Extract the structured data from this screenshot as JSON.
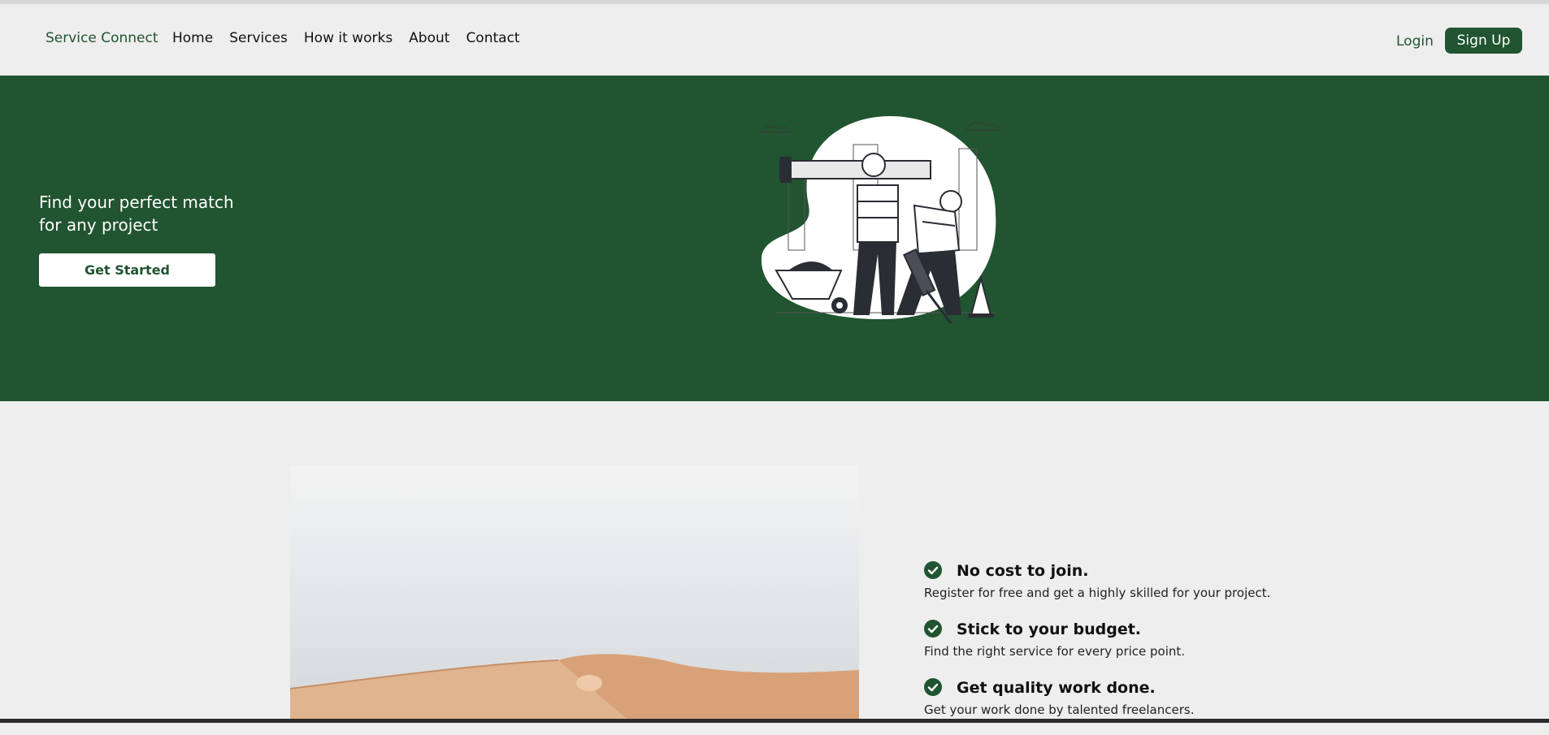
{
  "header": {
    "brand": "Service Connect",
    "nav": [
      "Home",
      "Services",
      "How it works",
      "About",
      "Contact"
    ],
    "login_label": "Login",
    "signup_label": "Sign Up"
  },
  "hero": {
    "headline": "Find your perfect match for any project",
    "cta_label": "Get Started",
    "illustration": "construction-workers-illustration"
  },
  "features": [
    {
      "title": "No cost to join.",
      "description": "Register for free and get a highly skilled for your project.",
      "icon": "check-circle-icon"
    },
    {
      "title": "Stick to your budget.",
      "description": "Find the right service for every price point.",
      "icon": "check-circle-icon"
    },
    {
      "title": "Get quality work done.",
      "description": "Get your work done by talented freelancers.",
      "icon": "check-circle-icon"
    }
  ],
  "colors": {
    "brand_green": "#215430",
    "background": "#eeeeee",
    "white": "#ffffff"
  }
}
